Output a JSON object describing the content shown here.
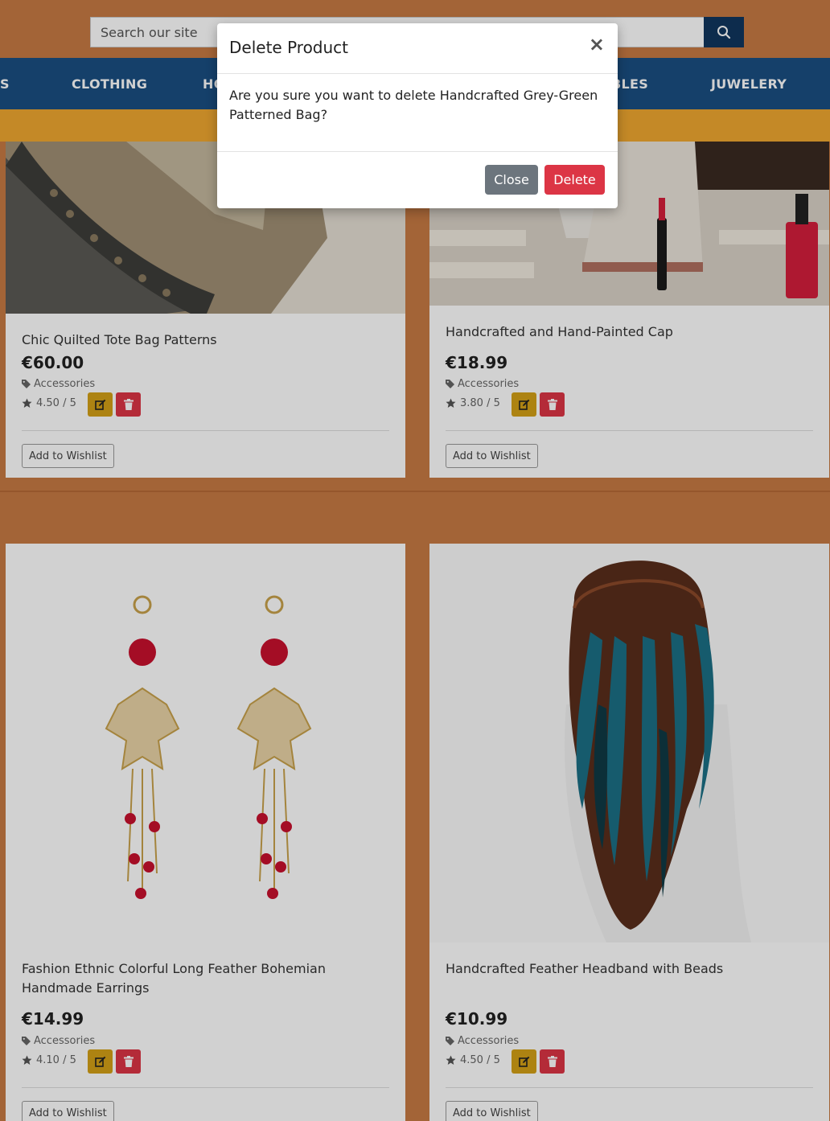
{
  "search": {
    "placeholder": "Search our site"
  },
  "nav": {
    "items": [
      {
        "label": "S"
      },
      {
        "label": "CLOTHING"
      },
      {
        "label": "HO"
      },
      {
        "label": "BLES"
      },
      {
        "label": "JUWELERY"
      }
    ]
  },
  "products": [
    {
      "title": "Chic Quilted Tote Bag Patterns",
      "price": "€60.00",
      "category": "Accessories",
      "rating": "4.50 / 5",
      "wishlist": "Add to Wishlist"
    },
    {
      "title": "Handcrafted and Hand-Painted Cap",
      "price": "€18.99",
      "category": "Accessories",
      "rating": "3.80 / 5",
      "wishlist": "Add to Wishlist"
    },
    {
      "title": "Fashion Ethnic Colorful Long Feather Bohemian Handmade Earrings",
      "price": "€14.99",
      "category": "Accessories",
      "rating": "4.10 / 5",
      "wishlist": "Add to Wishlist"
    },
    {
      "title": "Handcrafted Feather Headband with Beads",
      "price": "€10.99",
      "category": "Accessories",
      "rating": "4.50 / 5",
      "wishlist": "Add to Wishlist"
    }
  ],
  "modal": {
    "title": "Delete Product",
    "close_symbol": "×",
    "message": "Are you sure you want to delete Handcrafted Grey-Green Patterned Bag?",
    "close_label": "Close",
    "delete_label": "Delete"
  },
  "colors": {
    "background": "#c77a44",
    "nav": "#1a4f82",
    "promo": "#f0a830",
    "edit": "#d4a017",
    "delete": "#dc3545",
    "secondary": "#6c757d"
  }
}
